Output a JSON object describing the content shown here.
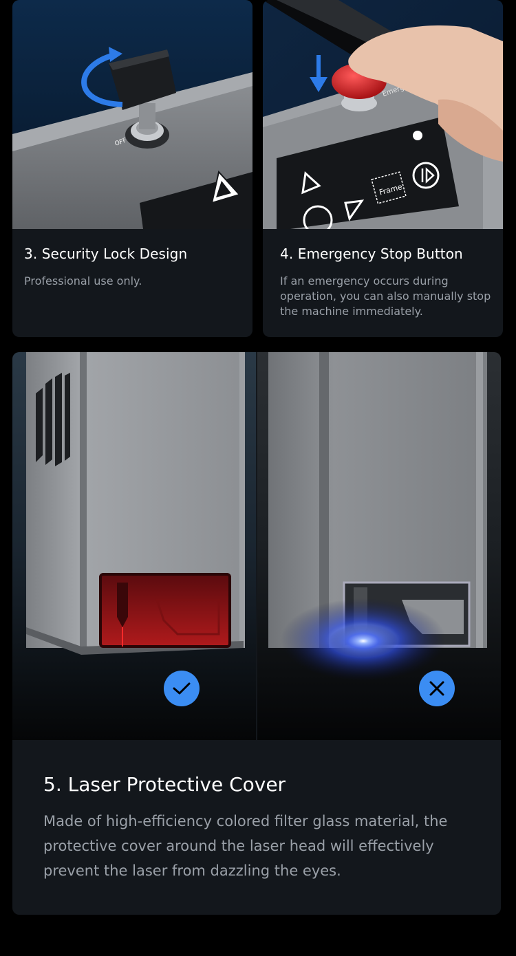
{
  "features": [
    {
      "title": "3. Security Lock Design",
      "description": "Professional use only.",
      "image_icon": "key-lock-icon"
    },
    {
      "title": "4. Emergency Stop Button",
      "description": "If an emergency occurs during operation, you can also manually stop the machine immediately.",
      "image_icon": "emergency-stop-icon",
      "panel_labels": {
        "frame": "Frame",
        "emergency": "Emergency",
        "off": "OFF"
      }
    }
  ],
  "cover": {
    "title": "5. Laser Protective Cover",
    "description": "Made of high-efficiency colored filter glass material, the protective cover around the laser head will effectively prevent the laser from dazzling the eyes.",
    "good_icon": "check-icon",
    "bad_icon": "close-icon"
  },
  "colors": {
    "card_bg": "#13171c",
    "accent_blue": "#3b8df3",
    "text_primary": "#ffffff",
    "text_secondary": "#9aa0a8",
    "estop_red": "#d0151a"
  }
}
